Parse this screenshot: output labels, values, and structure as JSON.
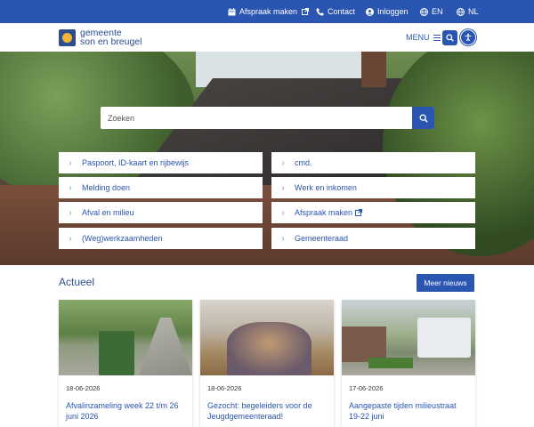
{
  "topbar": {
    "afspraak": "Afspraak maken",
    "contact": "Contact",
    "inloggen": "Inloggen",
    "lang_en": "EN",
    "lang_nl": "NL"
  },
  "header": {
    "logo_line1": "gemeente",
    "logo_line2": "son en breugel",
    "menu": "MENU"
  },
  "search": {
    "placeholder": "Zoeken"
  },
  "quicklinks": {
    "left": [
      "Paspoort, ID-kaart en rijbewijs",
      "Melding doen",
      "Afval en milieu",
      "(Weg)werkzaamheden"
    ],
    "right": [
      "cmd.",
      "Werk en inkomen",
      "Afspraak maken",
      "Gemeenteraad"
    ]
  },
  "news": {
    "title": "Actueel",
    "more": "Meer nieuws",
    "items": [
      {
        "date": "18-06-2026",
        "title": "Afvalinzameling week 22 t/m 26 juni 2026"
      },
      {
        "date": "18-06-2026",
        "title": "Gezocht: begeleiders voor de Jeugdgemeenteraad!"
      },
      {
        "date": "17-06-2026",
        "title": "Aangepaste tijden milieustraat 19-22 juni"
      }
    ]
  },
  "colors": {
    "brand": "#2a55b1",
    "logo": "#2c4d8f",
    "logo_sun": "#f2b633"
  }
}
